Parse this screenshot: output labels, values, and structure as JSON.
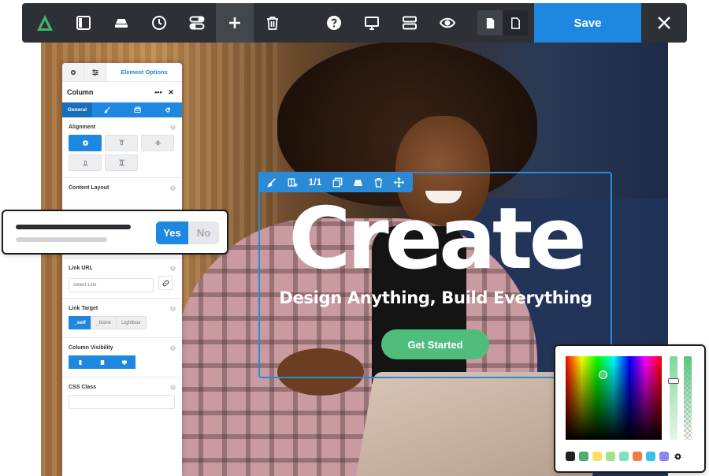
{
  "toolbar": {
    "save_label": "Save",
    "icons": [
      "logo-icon",
      "sidebar-icon",
      "layers-icon",
      "history-icon",
      "toggles-icon",
      "add-icon",
      "delete-icon",
      "help-icon",
      "desktop-icon",
      "layout-icon",
      "preview-icon",
      "page-filled-icon",
      "page-outline-icon",
      "close-icon"
    ]
  },
  "panel": {
    "tab_title": "Element Options",
    "header_title": "Column",
    "header_more": "•••",
    "subtabs": {
      "general": "General"
    },
    "sections": {
      "alignment": "Alignment",
      "content_layout": "Content Layout",
      "link_url": "Link URL",
      "link_url_placeholder": "Select Link",
      "link_target": "Link Target",
      "link_target_options": [
        "_self",
        "_blank",
        "Lightbox"
      ],
      "column_visibility": "Column Visibility",
      "css_class": "CSS Class"
    }
  },
  "toggle_card": {
    "yes_label": "Yes",
    "no_label": "No",
    "selected": "Yes"
  },
  "hero": {
    "headline": "Create",
    "subheadline": "Design Anything, Build Everything",
    "cta_label": "Get Started"
  },
  "selection_toolbar": {
    "fraction_label": "1/1"
  },
  "color_picker": {
    "swatches": [
      "#222222",
      "#4fae6a",
      "#ffe066",
      "#a4e38d",
      "#7ee0c2",
      "#f07b46",
      "#3ac1e6",
      "#8b86f5"
    ]
  },
  "colors": {
    "accent": "#1e88e0",
    "toolbar_bg": "#2d3035",
    "cta": "#4fbe7d"
  }
}
